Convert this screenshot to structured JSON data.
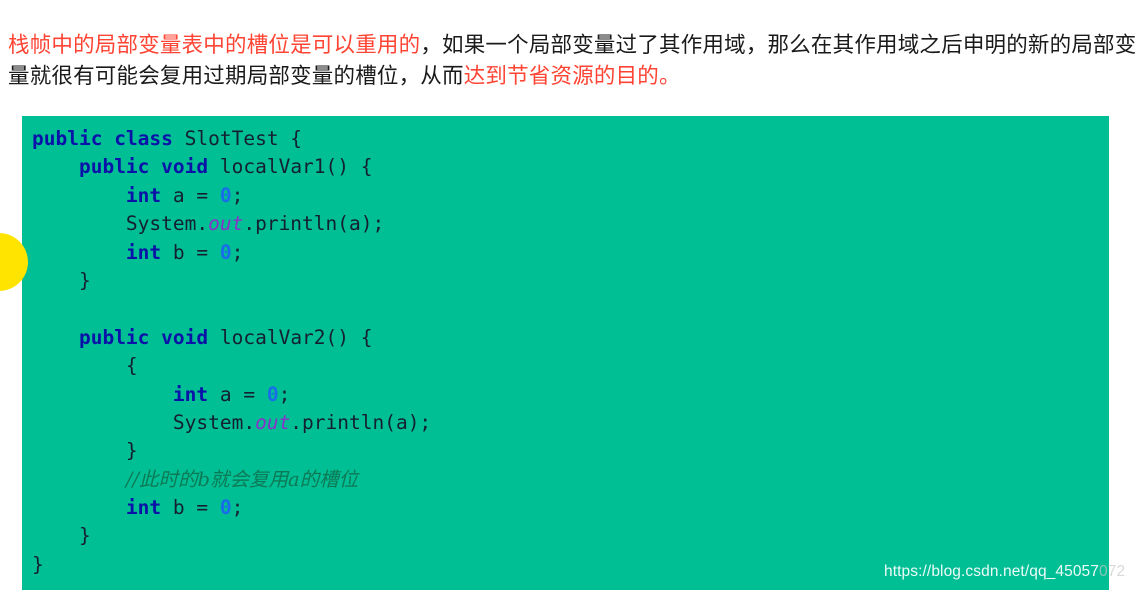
{
  "paragraph": {
    "segments": [
      {
        "text": "栈帧中的局部变量表中的槽位是可以重用的",
        "highlight": true
      },
      {
        "text": "，如果一个局部变量过了其作用域，那么在其作用域之后申明的新的局部变量就很有可能会复用过期局部变量的槽位，从而",
        "highlight": false
      },
      {
        "text": "达到节省资源的目的。",
        "highlight": true
      }
    ],
    "highlight_color": "#ff4433",
    "body_color": "#1a1a1a"
  },
  "code_block": {
    "language": "java",
    "background_color": "#00bf94",
    "keyword_color": "#0a12a8",
    "number_color": "#1a6de8",
    "field_color": "#8a32c8",
    "comment_color": "#0d7a56",
    "plain_color": "#14202f",
    "lines": [
      [
        {
          "t": "public",
          "c": "kw"
        },
        {
          "t": " ",
          "c": "pln"
        },
        {
          "t": "class",
          "c": "kw"
        },
        {
          "t": " SlotTest {",
          "c": "pln"
        }
      ],
      [
        {
          "t": "    ",
          "c": "pln"
        },
        {
          "t": "public",
          "c": "kw"
        },
        {
          "t": " ",
          "c": "pln"
        },
        {
          "t": "void",
          "c": "kw"
        },
        {
          "t": " localVar1() {",
          "c": "pln"
        }
      ],
      [
        {
          "t": "        ",
          "c": "pln"
        },
        {
          "t": "int",
          "c": "kw"
        },
        {
          "t": " a = ",
          "c": "pln"
        },
        {
          "t": "0",
          "c": "num"
        },
        {
          "t": ";",
          "c": "pln"
        }
      ],
      [
        {
          "t": "        System.",
          "c": "pln"
        },
        {
          "t": "out",
          "c": "fld"
        },
        {
          "t": ".println(a);",
          "c": "pln"
        }
      ],
      [
        {
          "t": "        ",
          "c": "pln"
        },
        {
          "t": "int",
          "c": "kw"
        },
        {
          "t": " b = ",
          "c": "pln"
        },
        {
          "t": "0",
          "c": "num"
        },
        {
          "t": ";",
          "c": "pln"
        }
      ],
      [
        {
          "t": "    }",
          "c": "pln"
        }
      ],
      [
        {
          "t": "",
          "c": "pln"
        }
      ],
      [
        {
          "t": "    ",
          "c": "pln"
        },
        {
          "t": "public",
          "c": "kw"
        },
        {
          "t": " ",
          "c": "pln"
        },
        {
          "t": "void",
          "c": "kw"
        },
        {
          "t": " localVar2() {",
          "c": "pln"
        }
      ],
      [
        {
          "t": "        {",
          "c": "pln"
        }
      ],
      [
        {
          "t": "            ",
          "c": "pln"
        },
        {
          "t": "int",
          "c": "kw"
        },
        {
          "t": " a = ",
          "c": "pln"
        },
        {
          "t": "0",
          "c": "num"
        },
        {
          "t": ";",
          "c": "pln"
        }
      ],
      [
        {
          "t": "            System.",
          "c": "pln"
        },
        {
          "t": "out",
          "c": "fld"
        },
        {
          "t": ".println(a);",
          "c": "pln"
        }
      ],
      [
        {
          "t": "        }",
          "c": "pln"
        }
      ],
      [
        {
          "t": "        ",
          "c": "pln"
        },
        {
          "t": "//此时的b就会复用a的槽位",
          "c": "cmt"
        }
      ],
      [
        {
          "t": "        ",
          "c": "pln"
        },
        {
          "t": "int",
          "c": "kw"
        },
        {
          "t": " b = ",
          "c": "pln"
        },
        {
          "t": "0",
          "c": "num"
        },
        {
          "t": ";",
          "c": "pln"
        }
      ],
      [
        {
          "t": "    }",
          "c": "pln"
        }
      ],
      [
        {
          "t": "}",
          "c": "pln"
        }
      ]
    ]
  },
  "marker": {
    "shape": "circle",
    "color": "#ffe400"
  },
  "watermark": {
    "visible_text": "https://blog.csdn.net/qq_45057",
    "tail_text": "072",
    "full_text": "https://blog.csdn.net/qq_45057072",
    "ghost_text": "https://blog.csdn.net/qq_45057072",
    "color": "#ffffff"
  }
}
